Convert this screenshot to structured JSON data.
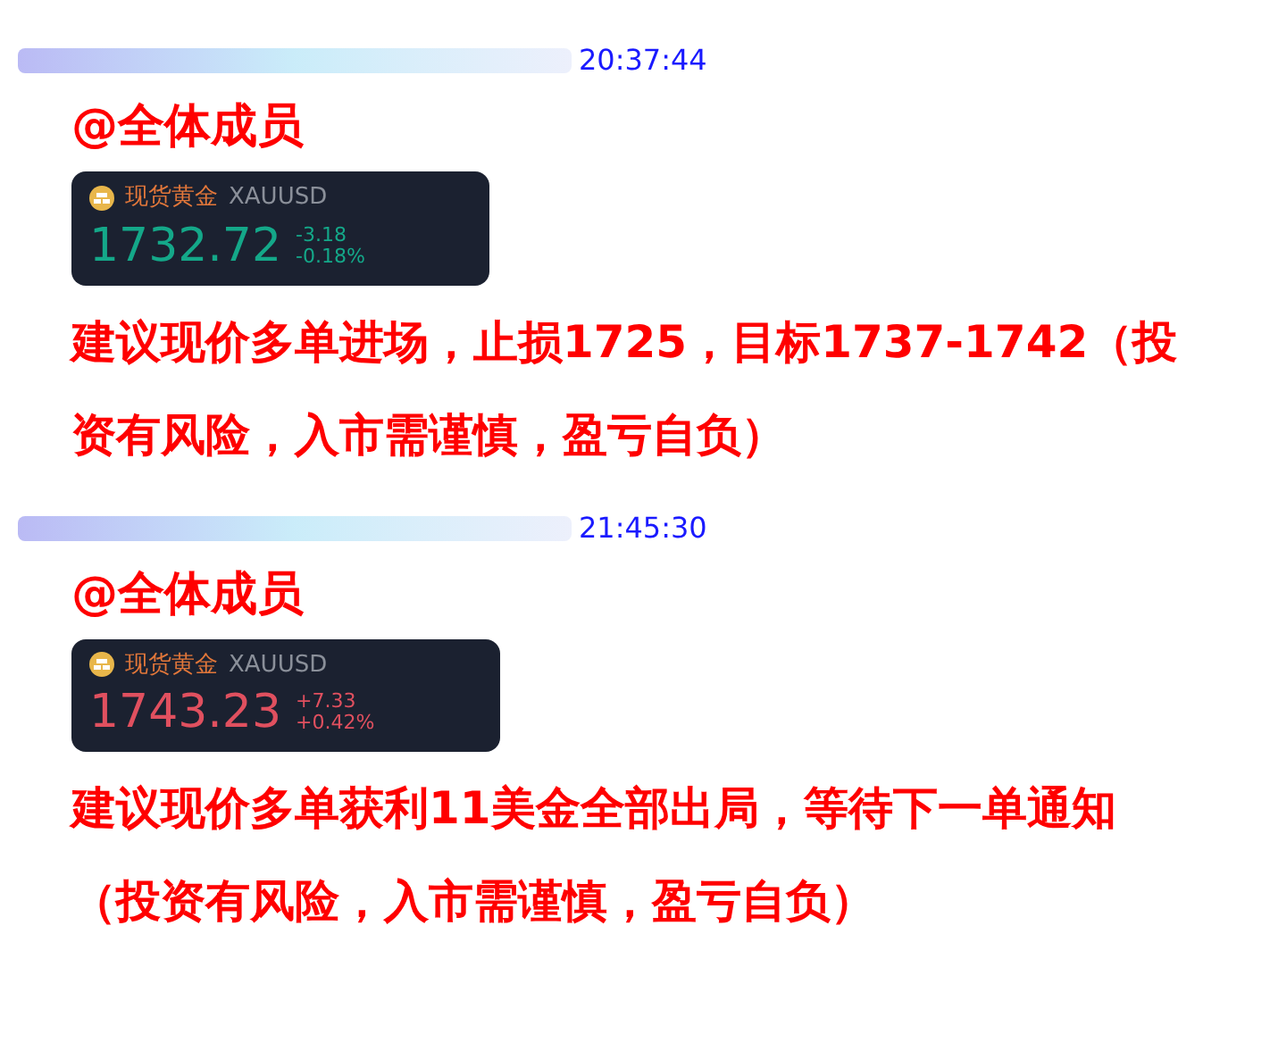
{
  "messages": [
    {
      "time": "20:37:44",
      "mention": "@全体成员",
      "quote": {
        "name": "现货黄金",
        "symbol": "XAUUSD",
        "price": "1732.72",
        "change": "-3.18",
        "percent": "-0.18%",
        "kind": "down"
      },
      "text": "建议现价多单进场，止损1725，目标1737-1742（投资有风险，入市需谨慎，盈亏自负）"
    },
    {
      "time": "21:45:30",
      "mention": "@全体成员",
      "quote": {
        "name": "现货黄金",
        "symbol": "XAUUSD",
        "price": "1743.23",
        "change": "+7.33",
        "percent": "+0.42%",
        "kind": "up"
      },
      "text": "建议现价多单获利11美金全部出局，等待下一单通知（投资有风险，入市需谨慎，盈亏自负）"
    }
  ]
}
